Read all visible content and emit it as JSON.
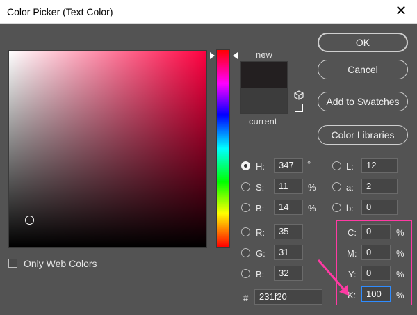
{
  "window": {
    "title": "Color Picker (Text Color)",
    "close_glyph": "✕"
  },
  "preview": {
    "new_label": "new",
    "current_label": "current",
    "new_color": "#231f20",
    "current_color": "#3c3c3c"
  },
  "buttons": {
    "ok": "OK",
    "cancel": "Cancel",
    "add_to_swatches": "Add to Swatches",
    "color_libraries": "Color Libraries"
  },
  "hsb": {
    "h": {
      "label": "H:",
      "value": "347",
      "unit": "°",
      "selected": true
    },
    "s": {
      "label": "S:",
      "value": "11",
      "unit": "%"
    },
    "b": {
      "label": "B:",
      "value": "14",
      "unit": "%"
    }
  },
  "lab": {
    "l": {
      "label": "L:",
      "value": "12"
    },
    "a": {
      "label": "a:",
      "value": "2"
    },
    "b": {
      "label": "b:",
      "value": "0"
    }
  },
  "rgb": {
    "r": {
      "label": "R:",
      "value": "35"
    },
    "g": {
      "label": "G:",
      "value": "31"
    },
    "b": {
      "label": "B:",
      "value": "32"
    }
  },
  "cmyk": {
    "c": {
      "label": "C:",
      "value": "0",
      "unit": "%"
    },
    "m": {
      "label": "M:",
      "value": "0",
      "unit": "%"
    },
    "y": {
      "label": "Y:",
      "value": "0",
      "unit": "%"
    },
    "k": {
      "label": "K:",
      "value": "100",
      "unit": "%"
    }
  },
  "hex": {
    "symbol": "#",
    "value": "231f20"
  },
  "only_web_colors": {
    "label": "Only Web Colors",
    "checked": false
  },
  "icons": {
    "close": "close-icon",
    "gamut_warning": "cube-icon",
    "web_safe": "web-safe-icon",
    "annotation_arrow": "arrow-icon"
  },
  "accent": {
    "highlight": "#ff3aa3",
    "focus": "#2f8cff"
  }
}
